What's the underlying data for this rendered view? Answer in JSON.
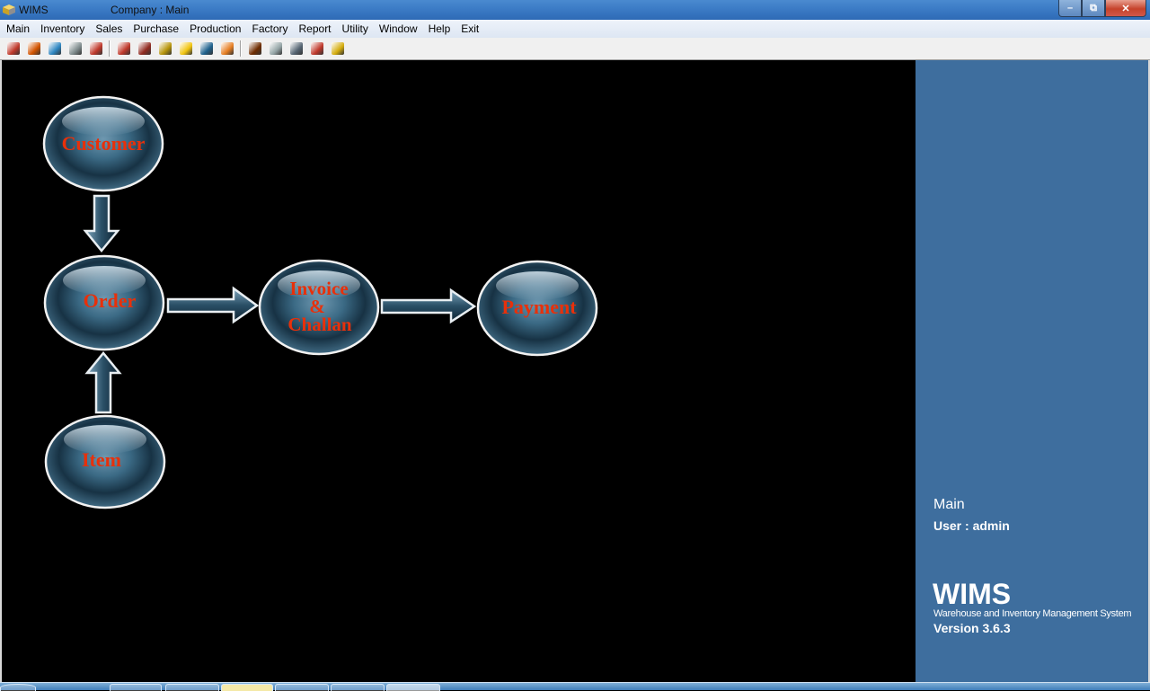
{
  "window": {
    "app_title": "WIMS",
    "company_label": "Company : Main",
    "controls": {
      "minimize": "–",
      "restore": "⧉",
      "close": "✕"
    }
  },
  "menu": {
    "items": [
      {
        "label": "Main"
      },
      {
        "label": "Inventory"
      },
      {
        "label": "Sales"
      },
      {
        "label": "Purchase"
      },
      {
        "label": "Production"
      },
      {
        "label": "Factory"
      },
      {
        "label": "Report"
      },
      {
        "label": "Utility"
      },
      {
        "label": "Window"
      },
      {
        "label": "Help"
      },
      {
        "label": "Exit"
      }
    ]
  },
  "toolbar": {
    "groups": [
      [
        {
          "icon": "chart-icon",
          "color": "#c0392b"
        },
        {
          "icon": "users-icon",
          "color": "#d35400"
        },
        {
          "icon": "bar-chart-icon",
          "color": "#2e86c1"
        },
        {
          "icon": "scale-icon",
          "color": "#7f8c8d"
        },
        {
          "icon": "pen-icon",
          "color": "#c0392b"
        }
      ],
      [
        {
          "icon": "address-book-icon",
          "color": "#c0392b"
        },
        {
          "icon": "book-icon",
          "color": "#922b21"
        },
        {
          "icon": "stack-icon",
          "color": "#b7950b"
        },
        {
          "icon": "notebook-icon",
          "color": "#f1c40f"
        },
        {
          "icon": "monitor-icon",
          "color": "#1f618d"
        },
        {
          "icon": "folder-icon",
          "color": "#e67e22"
        }
      ],
      [
        {
          "icon": "person-card-icon",
          "color": "#6e2c00"
        },
        {
          "icon": "clipboard-icon",
          "color": "#95a5a6"
        },
        {
          "icon": "library-icon",
          "color": "#566573"
        },
        {
          "icon": "tool-icon",
          "color": "#c0392b"
        },
        {
          "icon": "truck-icon",
          "color": "#d4ac0d"
        }
      ]
    ]
  },
  "diagram": {
    "nodes": {
      "customer": {
        "label": "Customer"
      },
      "order": {
        "label": "Order"
      },
      "item": {
        "label": "Item"
      },
      "invoice": {
        "line1": "Invoice",
        "line2": "&",
        "line3": "Challan"
      },
      "payment": {
        "label": "Payment"
      }
    },
    "flows": [
      {
        "from": "Customer",
        "to": "Order"
      },
      {
        "from": "Item",
        "to": "Order"
      },
      {
        "from": "Order",
        "to": "Invoice & Challan"
      },
      {
        "from": "Invoice & Challan",
        "to": "Payment"
      }
    ]
  },
  "side_panel": {
    "mode": "Main",
    "user": "User : admin",
    "brand": "WIMS",
    "tagline": "Warehouse and Inventory Management System",
    "version": "Version 3.6.3"
  }
}
